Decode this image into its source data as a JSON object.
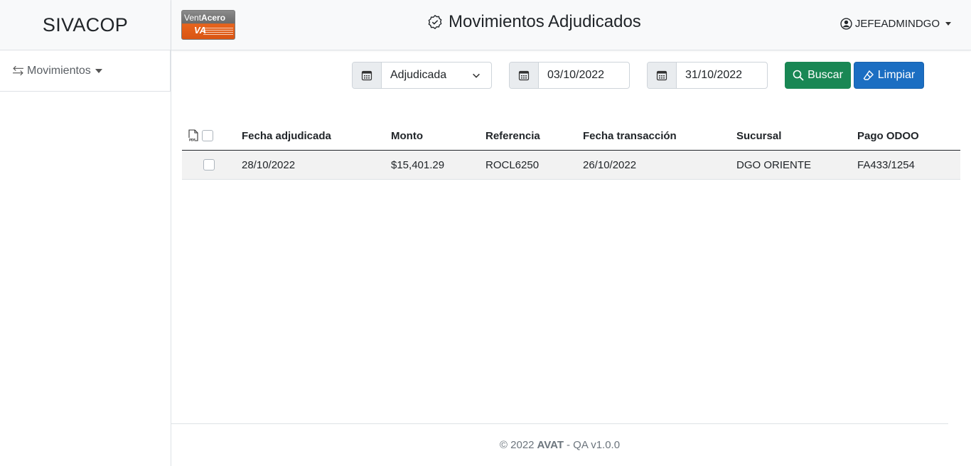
{
  "sidebar": {
    "brand": "SIVACOP",
    "items": [
      {
        "label": "Movimientos"
      }
    ]
  },
  "header": {
    "logo": {
      "text_light": "Vent",
      "text_bold": "Acero",
      "mark": "VA"
    },
    "title": "Movimientos Adjudicados",
    "user": "JEFEADMINDGO"
  },
  "filters": {
    "status": "Adjudicada",
    "date_from": "03/10/2022",
    "date_to": "31/10/2022",
    "search_label": "Buscar",
    "clear_label": "Limpiar"
  },
  "table": {
    "columns": [
      "Fecha adjudicada",
      "Monto",
      "Referencia",
      "Fecha transacción",
      "Sucursal",
      "Pago ODOO"
    ],
    "rows": [
      [
        "28/10/2022",
        "$15,401.29",
        "ROCL6250",
        "26/10/2022",
        "DGO ORIENTE",
        "FA433/1254"
      ]
    ]
  },
  "footer": {
    "prefix": "© 2022",
    "company": "AVAT",
    "suffix": "- QA v1.0.0"
  },
  "colors": {
    "search_button": "#198754",
    "clear_button": "#1b6ec2",
    "logo_orange": "#e8641c"
  }
}
